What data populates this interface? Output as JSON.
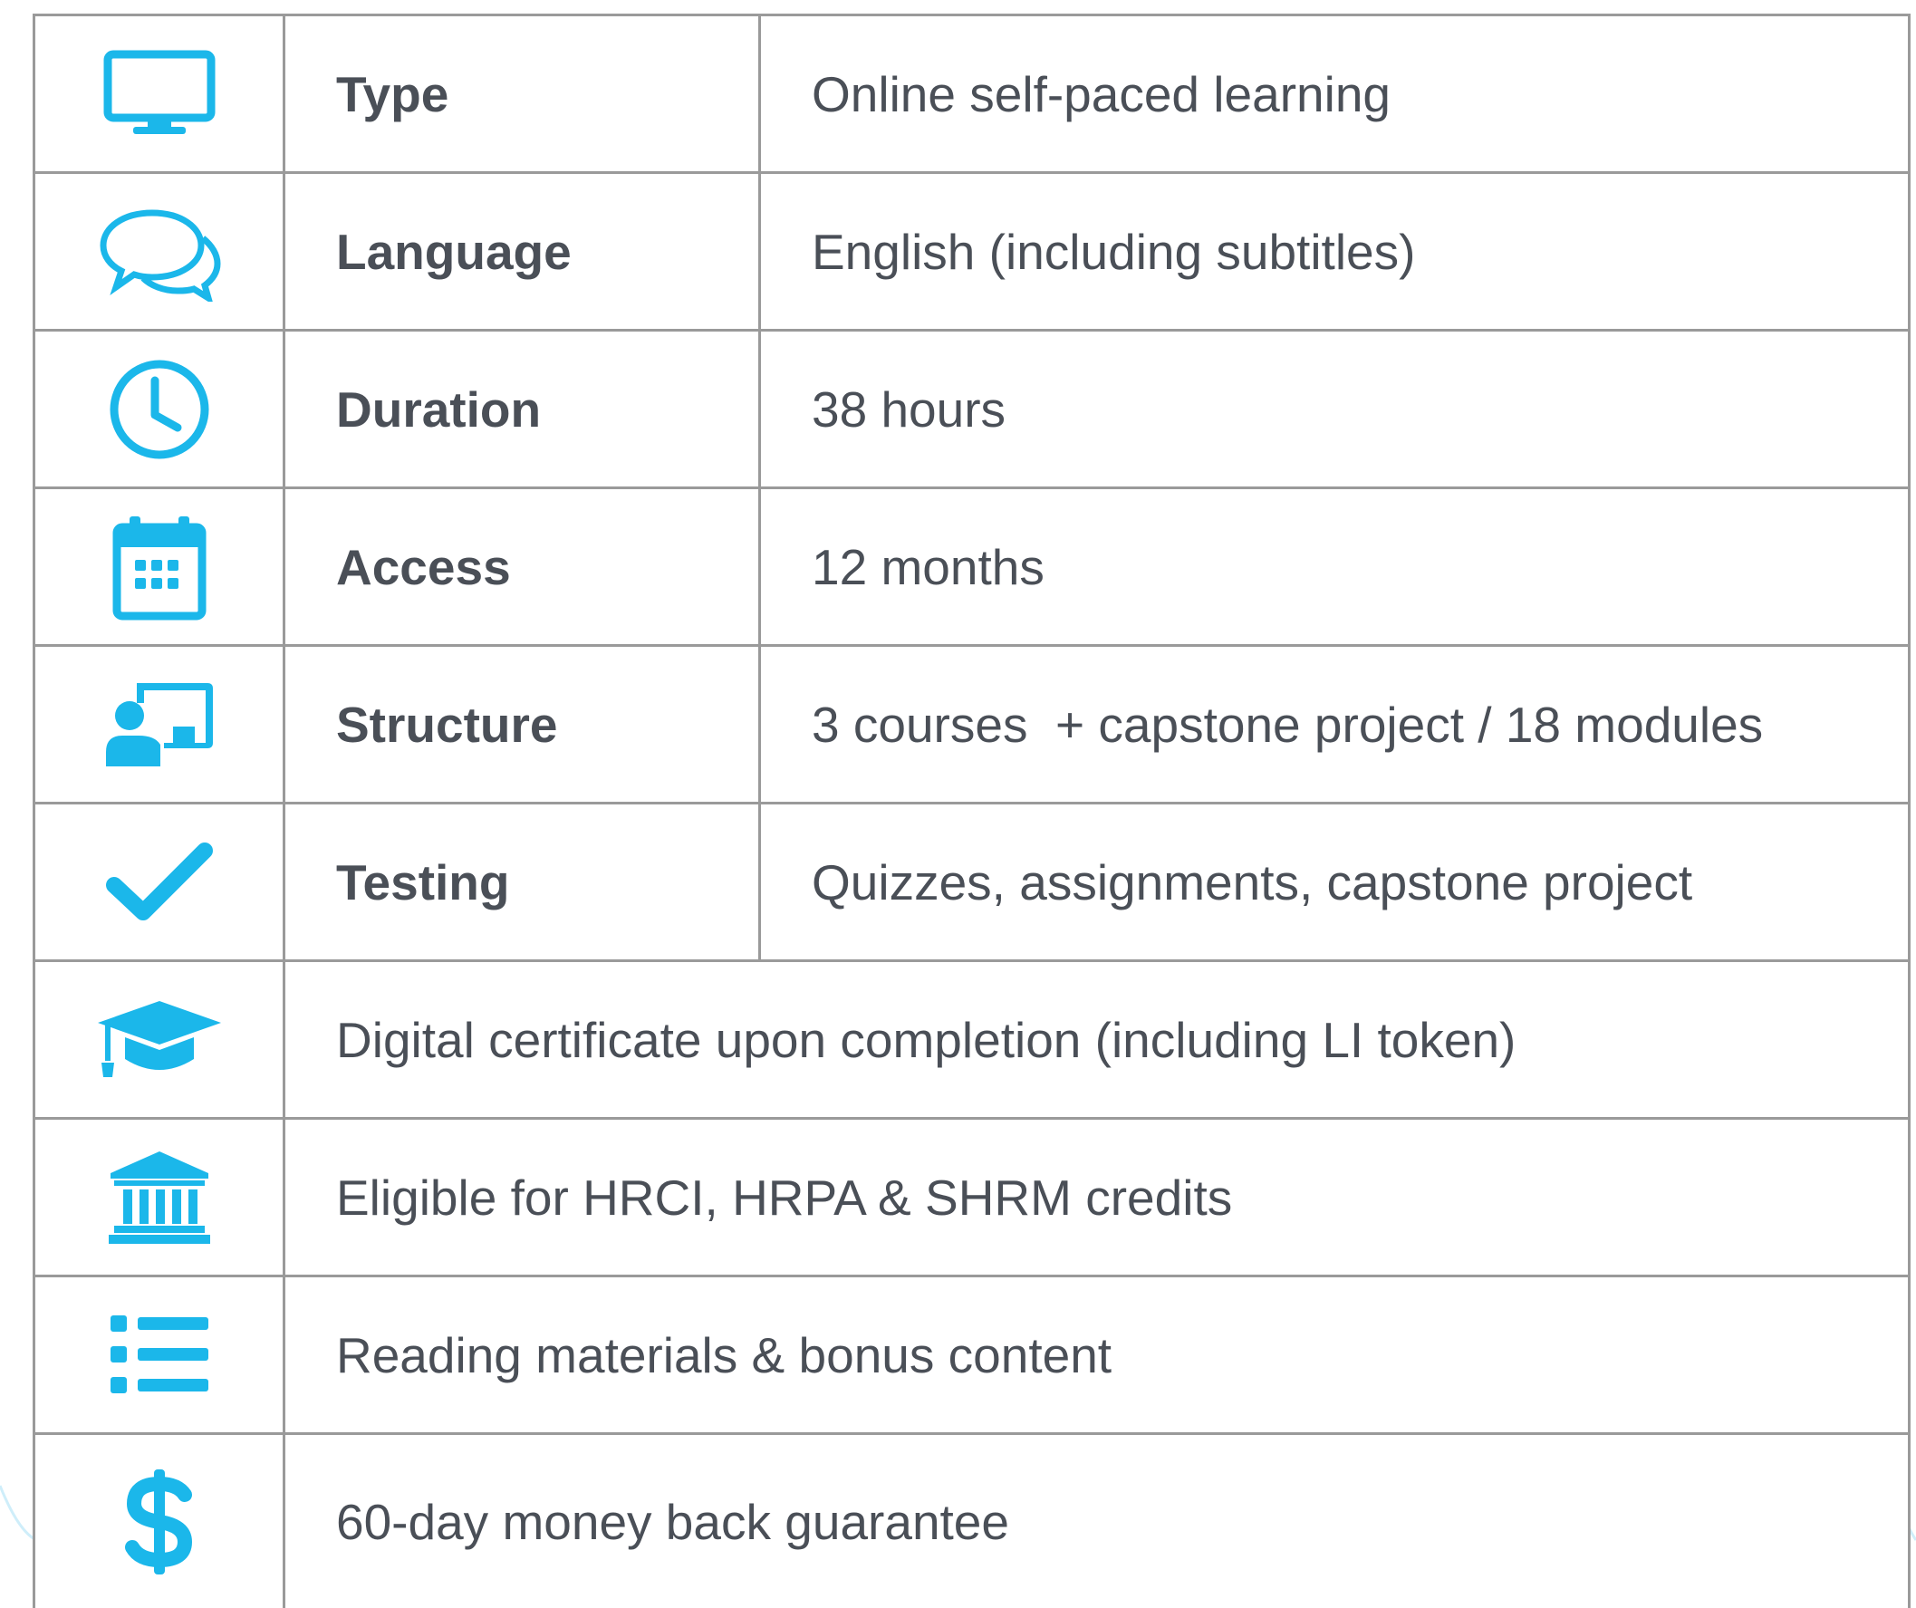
{
  "colors": {
    "accent": "#1bb7ea",
    "text": "#4a4f57",
    "border": "#9a9a9a"
  },
  "rows": [
    {
      "icon": "monitor-icon",
      "label": "Type",
      "value": "Online self-paced learning"
    },
    {
      "icon": "chat-bubbles-icon",
      "label": "Language",
      "value": "English (including subtitles)"
    },
    {
      "icon": "clock-icon",
      "label": "Duration",
      "value": "38 hours"
    },
    {
      "icon": "calendar-icon",
      "label": "Access",
      "value": "12 months"
    },
    {
      "icon": "presenter-board-icon",
      "label": "Structure",
      "value": "3 courses  + capstone project / 18 modules"
    },
    {
      "icon": "checkmark-icon",
      "label": "Testing",
      "value": "Quizzes, assignments, capstone project"
    }
  ],
  "features": [
    {
      "icon": "graduation-cap-icon",
      "text": "Digital certificate upon completion (including LI token)"
    },
    {
      "icon": "institution-icon",
      "text": "Eligible for HRCI, HRPA & SHRM credits"
    },
    {
      "icon": "list-icon",
      "text": "Reading materials & bonus content"
    },
    {
      "icon": "dollar-icon",
      "text": "60-day money back guarantee"
    }
  ]
}
